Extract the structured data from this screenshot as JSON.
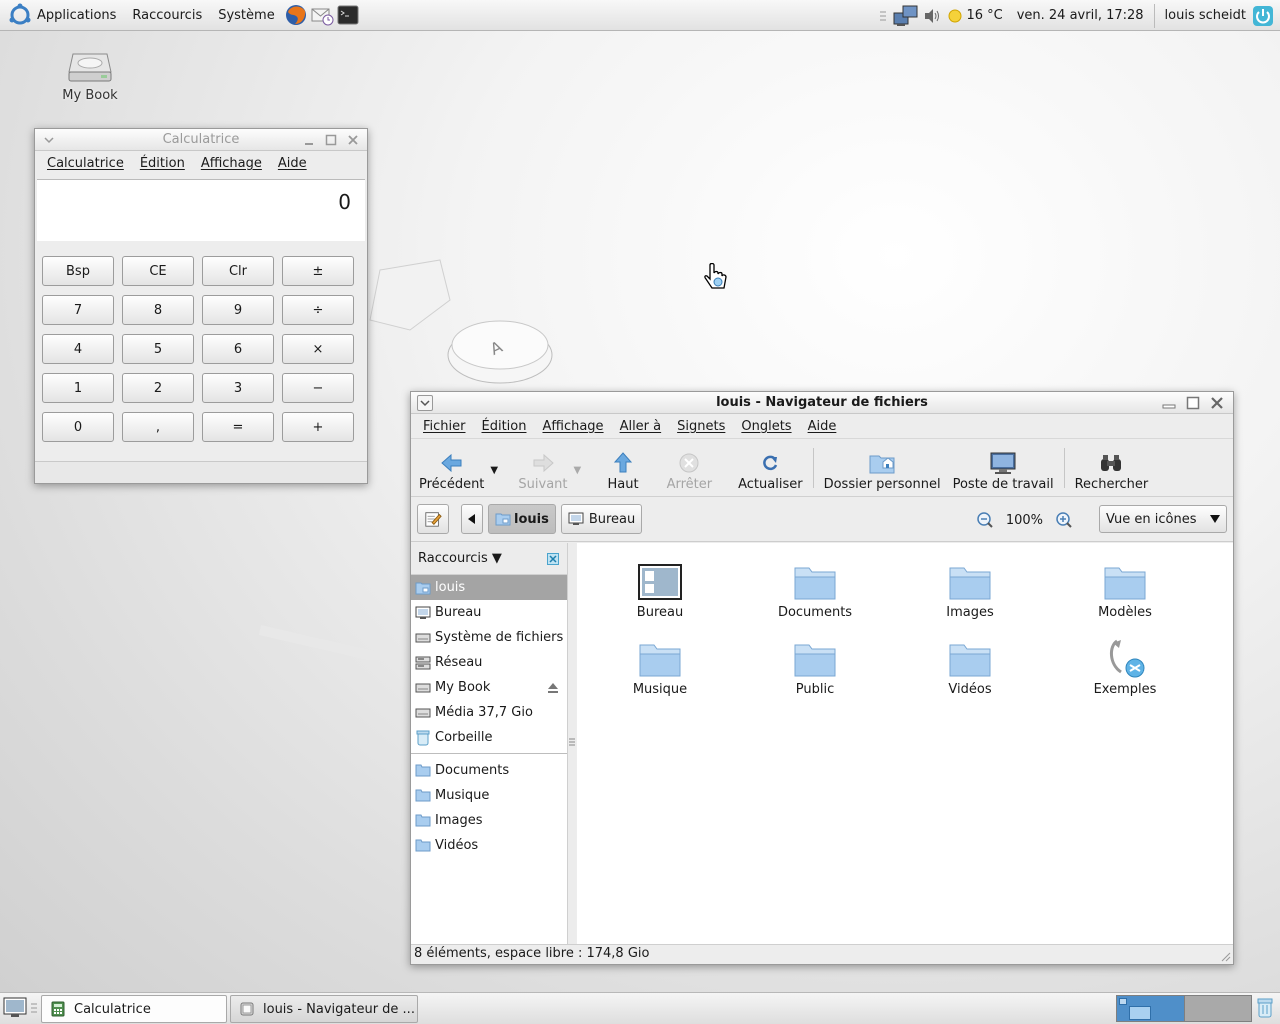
{
  "top_panel": {
    "menus": [
      "Applications",
      "Raccourcis",
      "Système"
    ],
    "launchers": [
      "firefox-icon",
      "mail-icon",
      "terminal-icon"
    ],
    "weather": "16 °C",
    "datetime": "ven. 24 avril, 17:28",
    "user": "louis scheidt"
  },
  "desktop": {
    "icons": [
      {
        "label": "My Book"
      }
    ]
  },
  "calculator": {
    "title": "Calculatrice",
    "menu": [
      "Calculatrice",
      "Édition",
      "Affichage",
      "Aide"
    ],
    "display": "0",
    "buttons": [
      "Bsp",
      "CE",
      "Clr",
      "±",
      "7",
      "8",
      "9",
      "÷",
      "4",
      "5",
      "6",
      "×",
      "1",
      "2",
      "3",
      "−",
      "0",
      ",",
      "=",
      "+"
    ]
  },
  "filemanager": {
    "title": "louis - Navigateur de fichiers",
    "menu": [
      "Fichier",
      "Édition",
      "Affichage",
      "Aller à",
      "Signets",
      "Onglets",
      "Aide"
    ],
    "toolbar": {
      "back": "Précédent",
      "forward": "Suivant",
      "up": "Haut",
      "stop": "Arrêter",
      "reload": "Actualiser",
      "home": "Dossier personnel",
      "computer": "Poste de travail",
      "search": "Rechercher"
    },
    "location": {
      "crumbs": [
        "louis",
        "Bureau"
      ],
      "zoom": "100%",
      "view": "Vue en icônes"
    },
    "sidebar": {
      "title": "Raccourcis",
      "places": [
        "louis",
        "Bureau",
        "Système de fichiers",
        "Réseau",
        "My Book",
        "Média 37,7 Gio",
        "Corbeille"
      ],
      "bookmarks": [
        "Documents",
        "Musique",
        "Images",
        "Vidéos"
      ]
    },
    "items": [
      "Bureau",
      "Documents",
      "Images",
      "Modèles",
      "Musique",
      "Public",
      "Vidéos",
      "Exemples"
    ],
    "status": "8 éléments, espace libre : 174,8 Gio"
  },
  "bottom_panel": {
    "tasks": [
      "Calculatrice",
      "louis - Navigateur de ..."
    ]
  },
  "colors": {
    "folder": "#a9cdef",
    "selection": "#a4a4a4",
    "pager_active": "#4f8fc9"
  }
}
